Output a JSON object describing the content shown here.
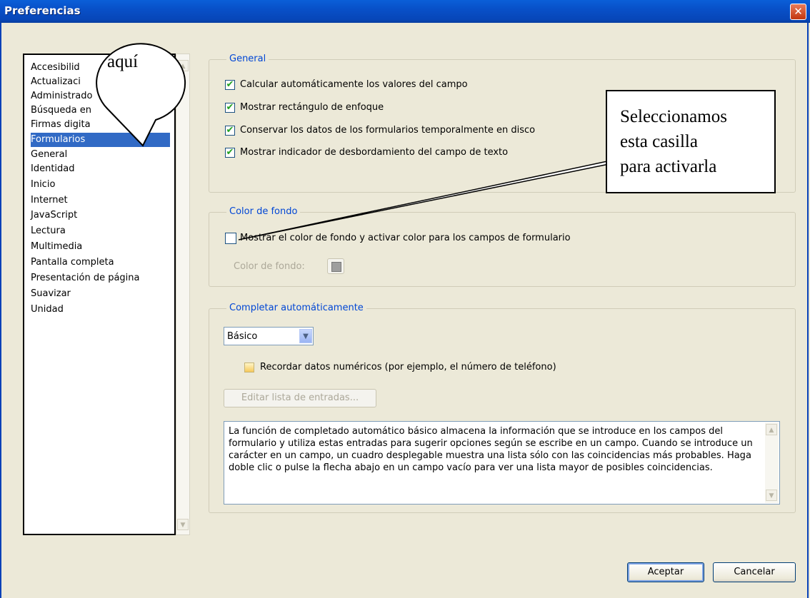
{
  "window": {
    "title": "Preferencias",
    "close_glyph": "✕"
  },
  "categories": {
    "items": [
      "Accesibilid",
      "Actualizaci",
      "Administrado",
      "Búsqueda en",
      "Firmas digita",
      "Formularios",
      "General",
      "Identidad",
      "Inicio",
      "Internet",
      "JavaScript",
      "Lectura",
      "Multimedia",
      "Pantalla completa",
      "Presentación de página",
      "Suavizar",
      "Unidad"
    ],
    "selected": "Formularios",
    "scroll_up": "▲",
    "scroll_down": "▼"
  },
  "general": {
    "legend": "General",
    "options": [
      {
        "label": "Calcular automáticamente los valores del campo",
        "checked": true
      },
      {
        "label": "Mostrar rectángulo de enfoque",
        "checked": true
      },
      {
        "label": "Conservar los datos de los formularios temporalmente en disco",
        "checked": true
      },
      {
        "label": "Mostrar indicador de desbordamiento del campo de texto",
        "checked": true
      }
    ],
    "check_glyph": "✔"
  },
  "background": {
    "legend": "Color de fondo",
    "option_label": "Mostrar el color de fondo y activar color para los campos de formulario",
    "option_checked": false,
    "color_label": "Color de fondo:"
  },
  "autocomplete": {
    "legend": "Completar automáticamente",
    "mode_value": "Básico",
    "combo_arrow": "▼",
    "remember_label": "Recordar datos numéricos (por ejemplo, el número de teléfono)",
    "edit_button": "Editar lista de entradas...",
    "description": "La función de completado automático básico almacena la información que se introduce en los campos del formulario y utiliza estas entradas para sugerir opciones según se escribe en un campo. Cuando se introduce un carácter en un campo, un cuadro desplegable muestra una lista sólo con las coincidencias más probables. Haga doble clic o pulse la flecha abajo en un campo vacío para ver una lista mayor de posibles coincidencias."
  },
  "buttons": {
    "ok": "Aceptar",
    "cancel": "Cancelar"
  },
  "annotations": {
    "callout_here": "aquí",
    "callout_instruction": [
      "Seleccionamos",
      "esta casilla",
      "para activarla"
    ]
  }
}
